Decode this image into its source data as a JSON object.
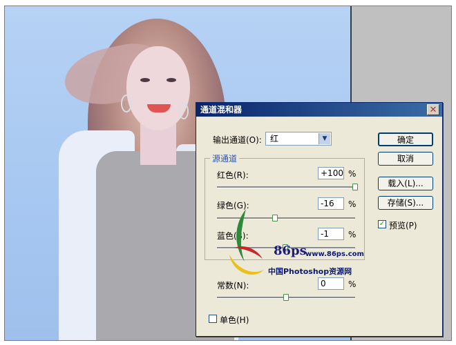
{
  "dialog": {
    "title": "通道混和器",
    "output_channel_label": "输出通道(O):",
    "output_channel_value": "红",
    "source_group_title": "源通道",
    "sliders": [
      {
        "label": "红色(R):",
        "value": "+100",
        "unit": "%",
        "level": 1.0
      },
      {
        "label": "绿色(G):",
        "value": "-16",
        "unit": "%",
        "level": 0.42
      },
      {
        "label": "蓝色(B):",
        "value": "-1",
        "unit": "%",
        "level": 0.495
      }
    ],
    "constant": {
      "label": "常数(N):",
      "value": "0",
      "unit": "%",
      "level": 0.5
    },
    "monochrome_label": "单色(H)",
    "monochrome_checked": false,
    "buttons": {
      "ok": "确定",
      "cancel": "取消",
      "load": "载入(L)...",
      "save": "存储(S)..."
    },
    "preview_label": "预览(P)",
    "preview_checked": true,
    "close_icon": "close-icon"
  },
  "watermark": {
    "logo_text": "86ps",
    "url": "www.86ps.com",
    "site_name": "中国Photoshop资源网"
  },
  "colors": {
    "photo_background": "#a8c8f2",
    "dialog_background": "#ece9d8",
    "title_bar": "#0a246a",
    "group_title": "#2655b8"
  }
}
